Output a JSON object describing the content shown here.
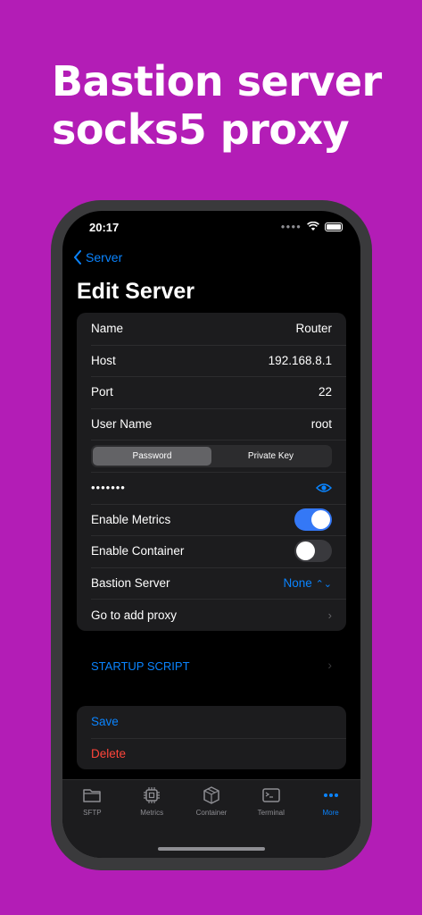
{
  "headline": {
    "line1": "Bastion server",
    "line2": "socks5 proxy"
  },
  "status": {
    "time": "20:17"
  },
  "nav": {
    "back_label": "Server",
    "title": "Edit Server"
  },
  "form": {
    "name_label": "Name",
    "name_value": "Router",
    "host_label": "Host",
    "host_value": "192.168.8.1",
    "port_label": "Port",
    "port_value": "22",
    "user_label": "User Name",
    "user_value": "root",
    "auth_tabs": [
      "Password",
      "Private Key"
    ],
    "password_mask": "•••••••",
    "metrics_label": "Enable Metrics",
    "metrics_on": true,
    "container_label": "Enable Container",
    "container_on": false,
    "bastion_label": "Bastion Server",
    "bastion_value": "None",
    "proxy_label": "Go to add proxy"
  },
  "startup_label": "STARTUP SCRIPT",
  "actions": {
    "save": "Save",
    "delete": "Delete"
  },
  "tabs": [
    {
      "label": "SFTP",
      "icon": "folder-icon"
    },
    {
      "label": "Metrics",
      "icon": "cpu-icon"
    },
    {
      "label": "Container",
      "icon": "box-icon"
    },
    {
      "label": "Terminal",
      "icon": "terminal-icon"
    },
    {
      "label": "More",
      "icon": "more-icon"
    }
  ],
  "colors": {
    "background": "#b31db6",
    "accent": "#0a84ff",
    "danger": "#ff453a",
    "toggle_on": "#3478f6"
  }
}
